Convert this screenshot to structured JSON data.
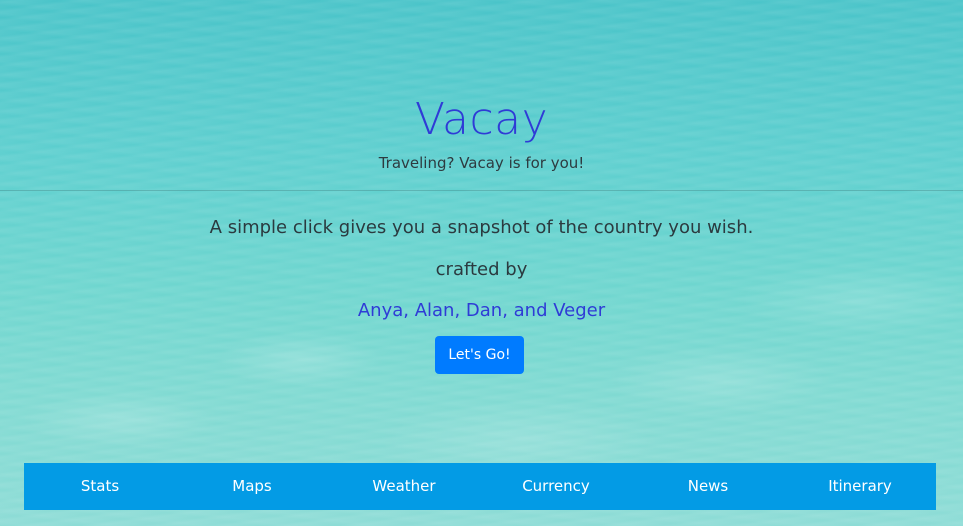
{
  "hero": {
    "title": "Vacay",
    "subtitle": "Traveling? Vacay is for you!",
    "description": "A simple click gives you a snapshot of the country you wish.",
    "crafted_by": "crafted by",
    "authors": "Anya, Alan, Dan, and Veger",
    "cta_label": "Let's Go!"
  },
  "nav": {
    "items": [
      {
        "label": "Stats"
      },
      {
        "label": "Maps"
      },
      {
        "label": "Weather"
      },
      {
        "label": "Currency"
      },
      {
        "label": "News"
      },
      {
        "label": "Itinerary"
      }
    ]
  },
  "colors": {
    "title": "#2f3bd6",
    "button": "#007bff",
    "navbar": "#039be5",
    "water": "#5dcfcf"
  }
}
